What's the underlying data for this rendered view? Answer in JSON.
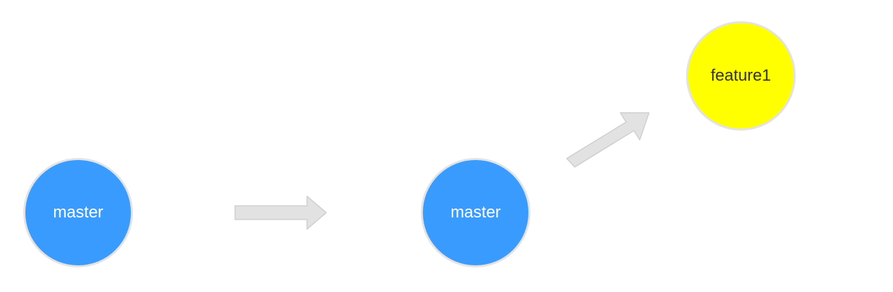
{
  "nodes": {
    "master_left": {
      "label": "master",
      "fill": "#3a9bff",
      "text_color": "#ffffff"
    },
    "master_right": {
      "label": "master",
      "fill": "#3a9bff",
      "text_color": "#ffffff"
    },
    "feature": {
      "label": "feature1",
      "fill": "#ffff00",
      "text_color": "#333333"
    }
  },
  "arrow_color": "#e2e2e2",
  "arrow_outline": "#cfcfcf",
  "node_border": "#e3e3e3"
}
